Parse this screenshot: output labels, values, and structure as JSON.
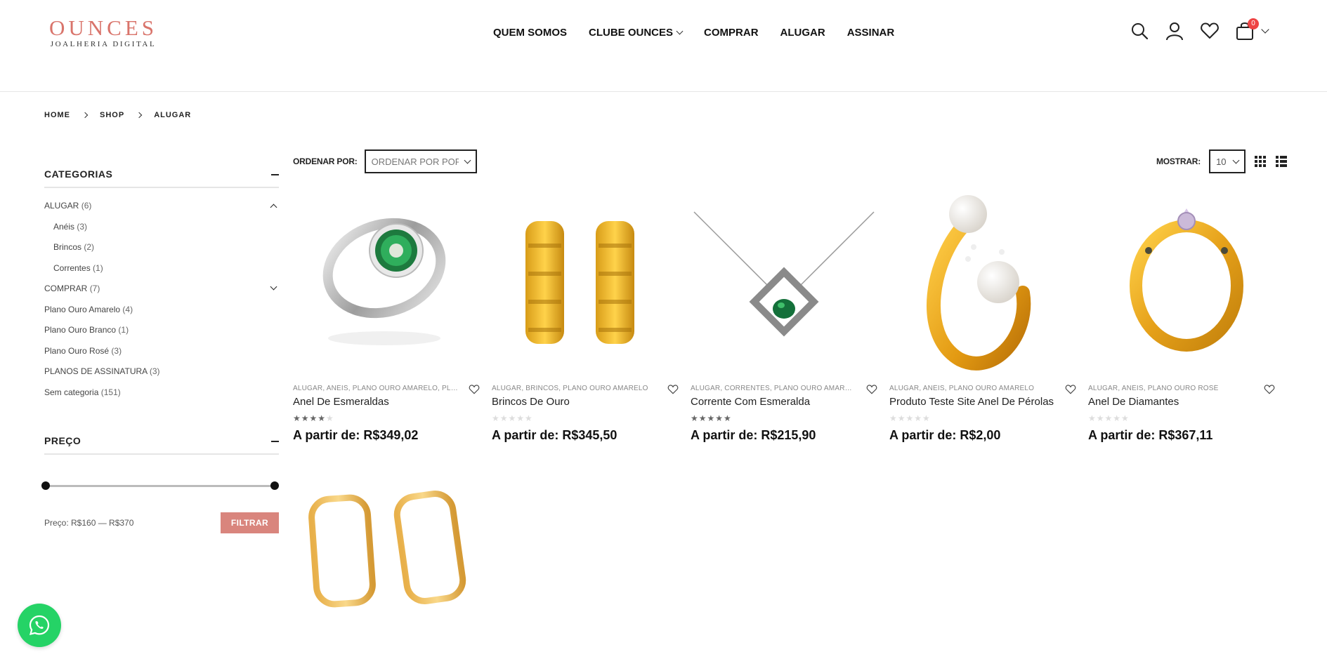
{
  "brand": {
    "name": "OUNCES",
    "tagline": "JOALHERIA DIGITAL",
    "color": "#d9746b"
  },
  "nav": [
    {
      "label": "QUEM SOMOS",
      "has_dropdown": false
    },
    {
      "label": "CLUBE OUNCES",
      "has_dropdown": true
    },
    {
      "label": "COMPRAR",
      "has_dropdown": false
    },
    {
      "label": "ALUGAR",
      "has_dropdown": false
    },
    {
      "label": "ASSINAR",
      "has_dropdown": false
    }
  ],
  "header_icons": [
    "search-icon",
    "user-icon",
    "heart-icon",
    "cart-icon"
  ],
  "cart": {
    "count": "0"
  },
  "breadcrumb": [
    "HOME",
    "SHOP",
    "ALUGAR"
  ],
  "sidebar": {
    "categories_title": "CATEGORIAS",
    "categories": [
      {
        "label": "ALUGAR",
        "count": "(6)",
        "level": 0,
        "toggle": "up"
      },
      {
        "label": "Anéis",
        "count": "(3)",
        "level": 1
      },
      {
        "label": "Brincos",
        "count": "(2)",
        "level": 1
      },
      {
        "label": "Correntes",
        "count": "(1)",
        "level": 1
      },
      {
        "label": "COMPRAR",
        "count": "(7)",
        "level": 0,
        "toggle": "down"
      },
      {
        "label": "Plano Ouro Amarelo",
        "count": "(4)",
        "level": 0
      },
      {
        "label": "Plano Ouro Branco",
        "count": "(1)",
        "level": 0
      },
      {
        "label": "Plano Ouro Rosé",
        "count": "(3)",
        "level": 0
      },
      {
        "label": "PLANOS DE ASSINATURA",
        "count": "(3)",
        "level": 0
      },
      {
        "label": "Sem categoria",
        "count": "(151)",
        "level": 0
      }
    ],
    "price_title": "PREÇO",
    "price_label": "Preço: R$160 — R$370",
    "price_range": {
      "min": 160,
      "max": 370,
      "selected_min": 160,
      "selected_max": 370
    },
    "filter_button": "FILTRAR",
    "filter_color": "#d9857d"
  },
  "toolbar": {
    "sort_label": "ORDENAR POR:",
    "sort_value": "ORDENAR POR POPULARIDADE",
    "show_label": "MOSTRAR:",
    "show_value": "10",
    "view_icons": [
      "grid-view-icon",
      "list-view-icon"
    ]
  },
  "products": [
    {
      "name": "Anel De Esmeraldas",
      "categories": "ALUGAR, ANÉIS, PLANO OURO AMARELO, PLANO OURO BRANCO",
      "rating": 4,
      "price": "A partir de: R$349,02",
      "image": "ring-emerald"
    },
    {
      "name": "Brincos De Ouro",
      "categories": "ALUGAR, BRINCOS, PLANO OURO AMARELO",
      "rating": 0,
      "price": "A partir de: R$345,50",
      "image": "earrings-chain"
    },
    {
      "name": "Corrente Com Esmeralda",
      "categories": "ALUGAR, CORRENTES, PLANO OURO AMARELO",
      "rating": 5,
      "price": "A partir de: R$215,90",
      "image": "necklace-emerald"
    },
    {
      "name": "Produto Teste Site Anel De Pérolas",
      "categories": "ALUGAR, ANÉIS, PLANO OURO AMARELO",
      "rating": 0,
      "price": "A partir de: R$2,00",
      "image": "ring-pearls"
    },
    {
      "name": "Anel De Diamantes",
      "categories": "ALUGAR, ANÉIS, PLANO OURO ROSÉ",
      "rating": 0,
      "price": "A partir de: R$367,11",
      "image": "ring-diamond"
    },
    {
      "name": "",
      "categories": "",
      "rating": null,
      "price": "",
      "image": "earrings-hoops"
    }
  ],
  "whatsapp": {
    "icon": "whatsapp-icon",
    "color": "#25d366"
  }
}
